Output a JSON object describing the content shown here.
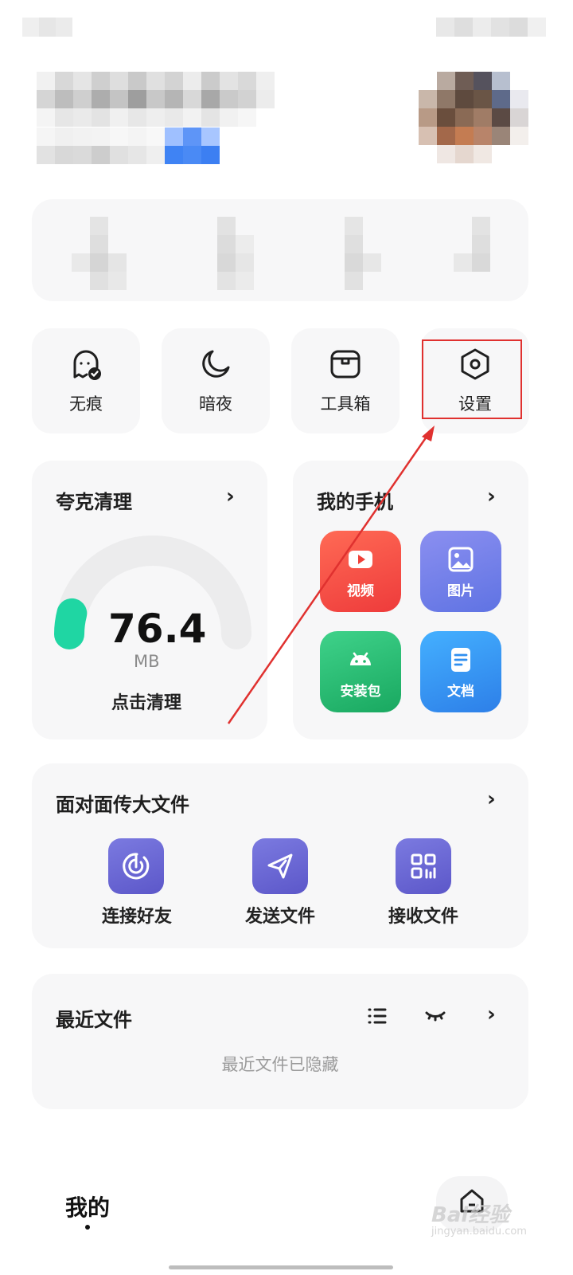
{
  "quick_actions": [
    {
      "label": "无痕",
      "icon": "ghost-check-icon"
    },
    {
      "label": "暗夜",
      "icon": "moon-icon"
    },
    {
      "label": "工具箱",
      "icon": "toolbox-icon"
    },
    {
      "label": "设置",
      "icon": "hexagon-settings-icon"
    }
  ],
  "cleaner": {
    "title": "夸克清理",
    "size_value": "76.4",
    "size_unit": "MB",
    "action": "点击清理",
    "used_fraction": 0.08
  },
  "my_phone": {
    "title": "我的手机",
    "tiles": [
      {
        "label": "视频",
        "icon": "video-play-icon",
        "color": "#f2453d"
      },
      {
        "label": "图片",
        "icon": "image-icon",
        "color": "#6f7be8"
      },
      {
        "label": "安装包",
        "icon": "android-icon",
        "color": "#22b46b"
      },
      {
        "label": "文档",
        "icon": "document-icon",
        "color": "#2f8ff0"
      }
    ]
  },
  "transfer": {
    "title": "面对面传大文件",
    "items": [
      {
        "label": "连接好友",
        "icon": "radar-icon"
      },
      {
        "label": "发送文件",
        "icon": "send-icon"
      },
      {
        "label": "接收文件",
        "icon": "qr-grid-icon"
      }
    ]
  },
  "recent": {
    "title": "最近文件",
    "empty_text": "最近文件已隐藏"
  },
  "bottom_nav": {
    "tab_label": "我的"
  },
  "watermark": {
    "text": "Bai经验",
    "sub": "jingyan.baidu.com"
  },
  "colors": {
    "accent_red": "#e0312f",
    "card_bg": "#f7f7f8",
    "gauge_green": "#1fd6a3",
    "transfer_purple": "#6a66d6"
  }
}
